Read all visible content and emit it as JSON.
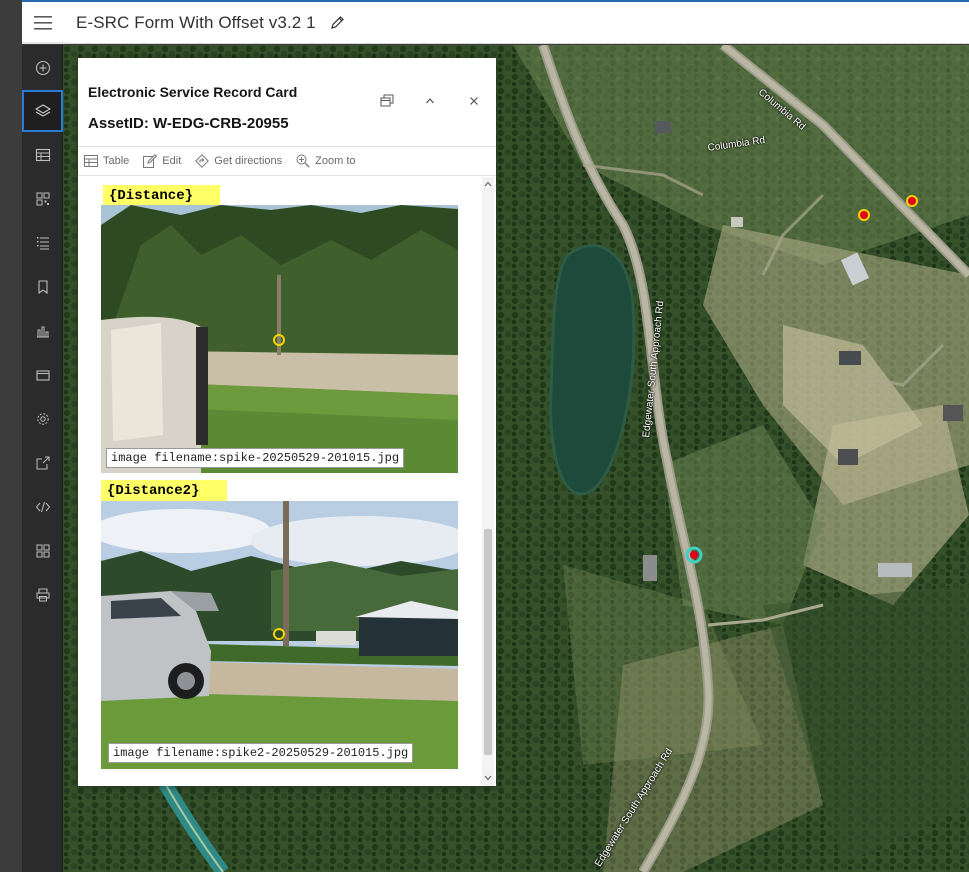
{
  "header": {
    "title": "E-SRC Form With Offset v3.2 1"
  },
  "actionbar": {
    "items": [
      {
        "icon": "add-data-icon",
        "active": false
      },
      {
        "icon": "layers-icon",
        "active": true
      },
      {
        "icon": "table-icon",
        "active": false
      },
      {
        "icon": "qr-grid-icon",
        "active": false
      },
      {
        "icon": "legend-list-icon",
        "active": false
      },
      {
        "icon": "bookmark-icon",
        "active": false
      },
      {
        "icon": "chart-icon",
        "active": false
      },
      {
        "icon": "folder-icon",
        "active": false
      },
      {
        "icon": "settings-gear-icon",
        "active": false
      },
      {
        "icon": "share-icon",
        "active": false
      },
      {
        "icon": "code-embed-icon",
        "active": false
      },
      {
        "icon": "widgets-grid-icon",
        "active": false
      },
      {
        "icon": "print-icon",
        "active": false
      }
    ]
  },
  "map": {
    "labels": {
      "columbia_rd_1": "Columbia Rd",
      "columbia_rd_2": "Columbia Rd",
      "edgewater_1": "Edgewater South Approach Rd",
      "edgewater_2": "Edgewater South Approach Rd"
    },
    "colors": {
      "point_fill": "#e0001b",
      "point_outline": "#f4d300",
      "selected_outline": "#3fd1c2"
    }
  },
  "popup": {
    "title": "Electronic Service Record Card",
    "subtitle": "AssetID: W-EDG-CRB-20955",
    "tools": {
      "table": "Table",
      "edit": "Edit",
      "directions": "Get directions",
      "zoom": "Zoom to"
    },
    "sections": [
      {
        "tag": "{Distance}",
        "caption": "image filename:spike-20250529-201015.jpg"
      },
      {
        "tag": "{Distance2}",
        "caption": "image filename:spike2-20250529-201015.jpg"
      }
    ]
  }
}
